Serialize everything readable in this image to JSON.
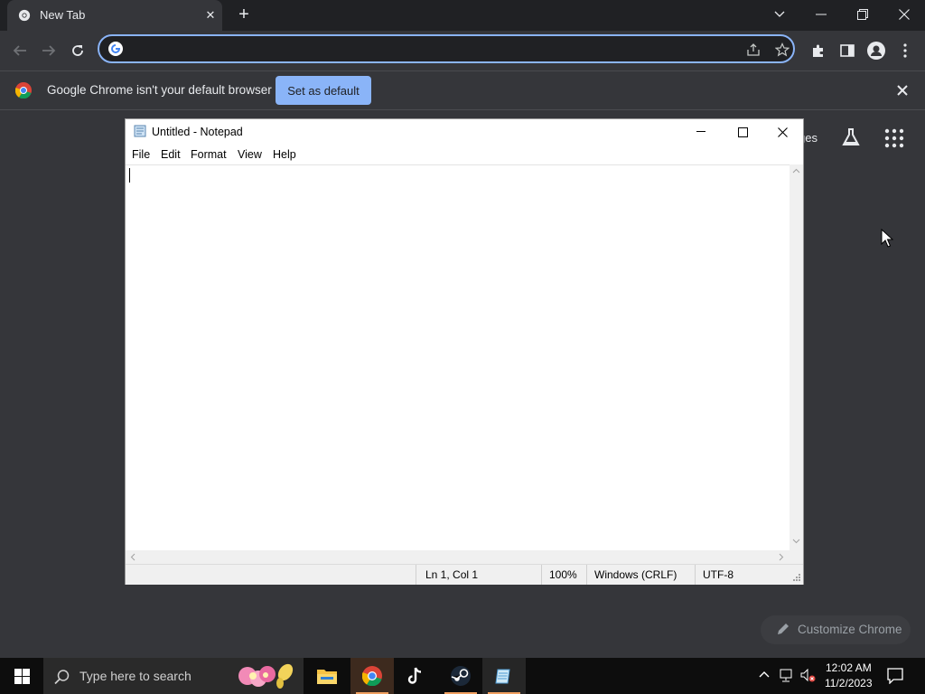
{
  "browser": {
    "tab_title": "New Tab",
    "omnibox_value": "",
    "infobar_text": "Google Chrome isn't your default browser",
    "set_default_label": "Set as default",
    "ntp_images_link": "ges",
    "customize_label": "Customize Chrome",
    "accent": "#8ab4f8"
  },
  "notepad": {
    "title": "Untitled - Notepad",
    "menu": [
      "File",
      "Edit",
      "Format",
      "View",
      "Help"
    ],
    "content": "",
    "status": {
      "position": "Ln 1, Col 1",
      "zoom": "100%",
      "line_ending": "Windows (CRLF)",
      "encoding": "UTF-8"
    }
  },
  "taskbar": {
    "search_placeholder": "Type here to search",
    "time": "12:02 AM",
    "date": "11/2/2023",
    "apps": [
      "file-explorer-icon",
      "chrome-icon",
      "tiktok-icon",
      "steam-icon",
      "notepad-icon"
    ]
  }
}
